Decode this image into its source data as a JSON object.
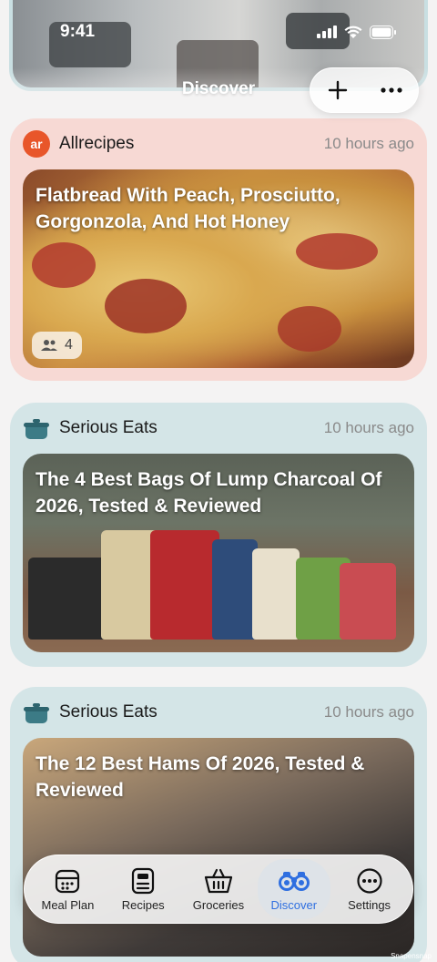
{
  "status_bar": {
    "time": "9:41"
  },
  "header": {
    "title": "Discover"
  },
  "feed": [
    {
      "source": "Allrecipes",
      "source_icon": "allrecipes-logo-icon",
      "time": "10 hours ago",
      "title": "Flatbread With Peach, Prosciutto, Gorgonzola, And Hot Honey",
      "saves": "4"
    },
    {
      "source": "Serious Eats",
      "source_icon": "pot-icon",
      "time": "10 hours ago",
      "title": "The 4 Best Bags Of Lump Charcoal Of 2026, Tested & Reviewed"
    },
    {
      "source": "Serious Eats",
      "source_icon": "pot-icon",
      "time": "10 hours ago",
      "title": "The 12 Best Hams Of 2026, Tested & Reviewed"
    }
  ],
  "tabs": [
    {
      "label": "Meal Plan",
      "icon": "meal-plan-icon"
    },
    {
      "label": "Recipes",
      "icon": "recipes-icon"
    },
    {
      "label": "Groceries",
      "icon": "basket-icon"
    },
    {
      "label": "Discover",
      "icon": "binoculars-icon"
    },
    {
      "label": "Settings",
      "icon": "more-icon"
    }
  ],
  "colors": {
    "accent": "#2f6fe0",
    "allrecipes": "#e8562a",
    "pink_card": "#f7d9d4",
    "blue_card": "#d4e5e7"
  },
  "credit": "Snapensnap"
}
